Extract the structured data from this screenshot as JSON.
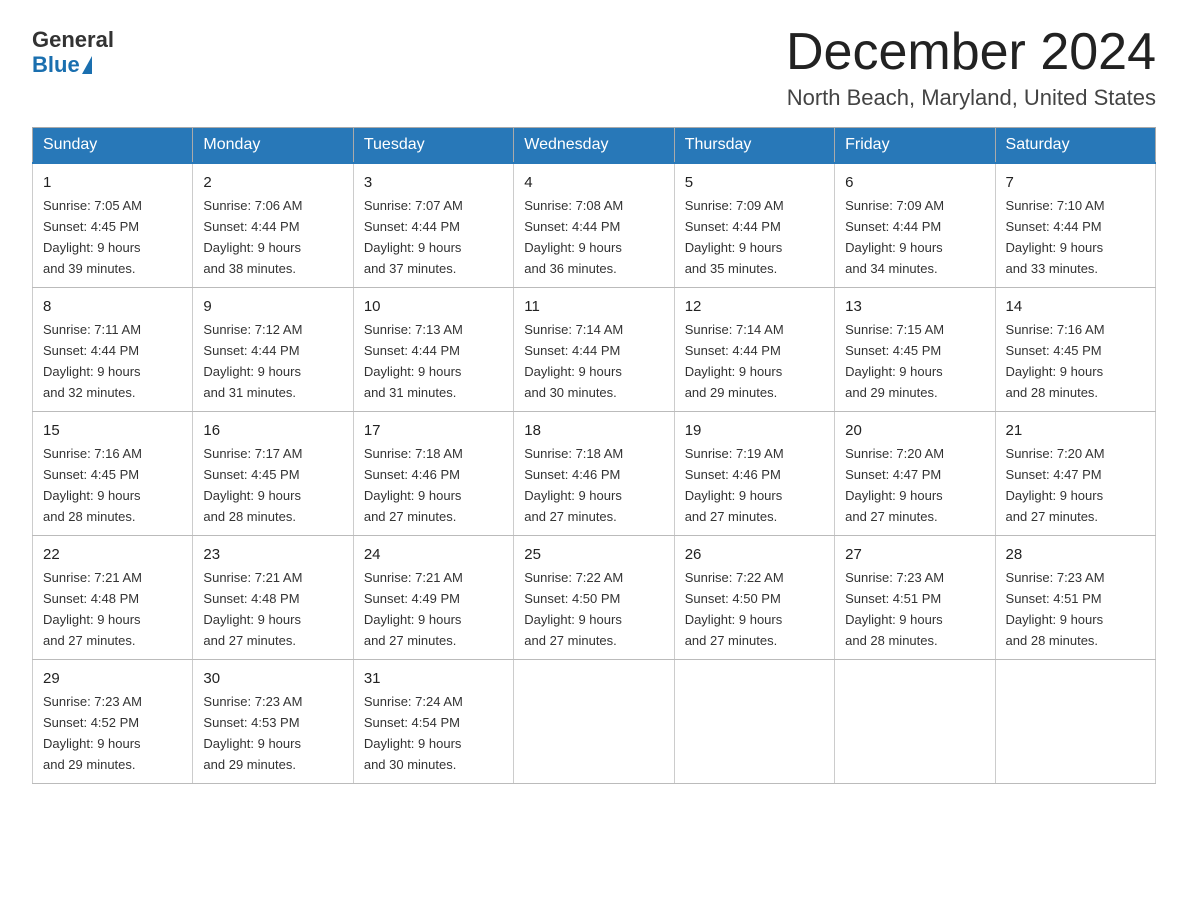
{
  "header": {
    "logo_general": "General",
    "logo_blue": "Blue",
    "month_title": "December 2024",
    "location": "North Beach, Maryland, United States"
  },
  "days_of_week": [
    "Sunday",
    "Monday",
    "Tuesday",
    "Wednesday",
    "Thursday",
    "Friday",
    "Saturday"
  ],
  "weeks": [
    [
      {
        "day": "1",
        "sunrise": "7:05 AM",
        "sunset": "4:45 PM",
        "daylight": "9 hours and 39 minutes."
      },
      {
        "day": "2",
        "sunrise": "7:06 AM",
        "sunset": "4:44 PM",
        "daylight": "9 hours and 38 minutes."
      },
      {
        "day": "3",
        "sunrise": "7:07 AM",
        "sunset": "4:44 PM",
        "daylight": "9 hours and 37 minutes."
      },
      {
        "day": "4",
        "sunrise": "7:08 AM",
        "sunset": "4:44 PM",
        "daylight": "9 hours and 36 minutes."
      },
      {
        "day": "5",
        "sunrise": "7:09 AM",
        "sunset": "4:44 PM",
        "daylight": "9 hours and 35 minutes."
      },
      {
        "day": "6",
        "sunrise": "7:09 AM",
        "sunset": "4:44 PM",
        "daylight": "9 hours and 34 minutes."
      },
      {
        "day": "7",
        "sunrise": "7:10 AM",
        "sunset": "4:44 PM",
        "daylight": "9 hours and 33 minutes."
      }
    ],
    [
      {
        "day": "8",
        "sunrise": "7:11 AM",
        "sunset": "4:44 PM",
        "daylight": "9 hours and 32 minutes."
      },
      {
        "day": "9",
        "sunrise": "7:12 AM",
        "sunset": "4:44 PM",
        "daylight": "9 hours and 31 minutes."
      },
      {
        "day": "10",
        "sunrise": "7:13 AM",
        "sunset": "4:44 PM",
        "daylight": "9 hours and 31 minutes."
      },
      {
        "day": "11",
        "sunrise": "7:14 AM",
        "sunset": "4:44 PM",
        "daylight": "9 hours and 30 minutes."
      },
      {
        "day": "12",
        "sunrise": "7:14 AM",
        "sunset": "4:44 PM",
        "daylight": "9 hours and 29 minutes."
      },
      {
        "day": "13",
        "sunrise": "7:15 AM",
        "sunset": "4:45 PM",
        "daylight": "9 hours and 29 minutes."
      },
      {
        "day": "14",
        "sunrise": "7:16 AM",
        "sunset": "4:45 PM",
        "daylight": "9 hours and 28 minutes."
      }
    ],
    [
      {
        "day": "15",
        "sunrise": "7:16 AM",
        "sunset": "4:45 PM",
        "daylight": "9 hours and 28 minutes."
      },
      {
        "day": "16",
        "sunrise": "7:17 AM",
        "sunset": "4:45 PM",
        "daylight": "9 hours and 28 minutes."
      },
      {
        "day": "17",
        "sunrise": "7:18 AM",
        "sunset": "4:46 PM",
        "daylight": "9 hours and 27 minutes."
      },
      {
        "day": "18",
        "sunrise": "7:18 AM",
        "sunset": "4:46 PM",
        "daylight": "9 hours and 27 minutes."
      },
      {
        "day": "19",
        "sunrise": "7:19 AM",
        "sunset": "4:46 PM",
        "daylight": "9 hours and 27 minutes."
      },
      {
        "day": "20",
        "sunrise": "7:20 AM",
        "sunset": "4:47 PM",
        "daylight": "9 hours and 27 minutes."
      },
      {
        "day": "21",
        "sunrise": "7:20 AM",
        "sunset": "4:47 PM",
        "daylight": "9 hours and 27 minutes."
      }
    ],
    [
      {
        "day": "22",
        "sunrise": "7:21 AM",
        "sunset": "4:48 PM",
        "daylight": "9 hours and 27 minutes."
      },
      {
        "day": "23",
        "sunrise": "7:21 AM",
        "sunset": "4:48 PM",
        "daylight": "9 hours and 27 minutes."
      },
      {
        "day": "24",
        "sunrise": "7:21 AM",
        "sunset": "4:49 PM",
        "daylight": "9 hours and 27 minutes."
      },
      {
        "day": "25",
        "sunrise": "7:22 AM",
        "sunset": "4:50 PM",
        "daylight": "9 hours and 27 minutes."
      },
      {
        "day": "26",
        "sunrise": "7:22 AM",
        "sunset": "4:50 PM",
        "daylight": "9 hours and 27 minutes."
      },
      {
        "day": "27",
        "sunrise": "7:23 AM",
        "sunset": "4:51 PM",
        "daylight": "9 hours and 28 minutes."
      },
      {
        "day": "28",
        "sunrise": "7:23 AM",
        "sunset": "4:51 PM",
        "daylight": "9 hours and 28 minutes."
      }
    ],
    [
      {
        "day": "29",
        "sunrise": "7:23 AM",
        "sunset": "4:52 PM",
        "daylight": "9 hours and 29 minutes."
      },
      {
        "day": "30",
        "sunrise": "7:23 AM",
        "sunset": "4:53 PM",
        "daylight": "9 hours and 29 minutes."
      },
      {
        "day": "31",
        "sunrise": "7:24 AM",
        "sunset": "4:54 PM",
        "daylight": "9 hours and 30 minutes."
      },
      null,
      null,
      null,
      null
    ]
  ],
  "labels": {
    "sunrise": "Sunrise:",
    "sunset": "Sunset:",
    "daylight": "Daylight:"
  }
}
